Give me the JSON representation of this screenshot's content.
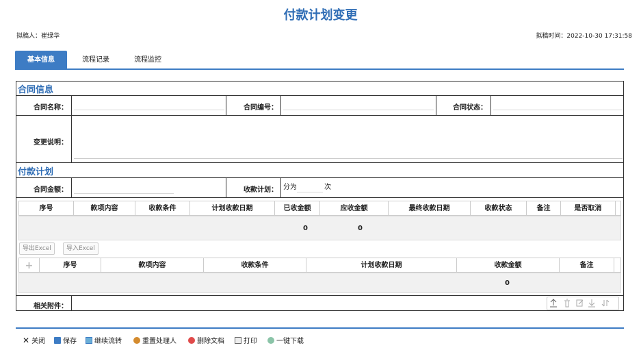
{
  "page": {
    "title": "付款计划变更",
    "drafter_label": "拟稿人：崔绿华",
    "draft_time_label": "拟稿时间：2022-10-30 17:31:58"
  },
  "tabs": [
    "基本信息",
    "流程记录",
    "流程监控"
  ],
  "contract_section": {
    "title": "合同信息",
    "name_label": "合同名称：",
    "number_label": "合同编号：",
    "status_label": "合同状态：",
    "change_desc_label": "变更说明："
  },
  "payment_section": {
    "title": "付款计划",
    "amount_label": "合同金额：",
    "plan_label": "收款计划：",
    "plan_prefix": "分为",
    "plan_suffix": "次"
  },
  "grid1": {
    "headers": [
      "序号",
      "款项内容",
      "收款条件",
      "计划收款日期",
      "已收金额",
      "应收金额",
      "最终收款日期",
      "收款状态",
      "备注",
      "是否取消"
    ],
    "totals": [
      "0",
      "0"
    ]
  },
  "grid_buttons": {
    "export": "导出Excel",
    "import": "导入Excel"
  },
  "grid2": {
    "headers": [
      "序号",
      "款项内容",
      "收款条件",
      "计划收款日期",
      "收款金额",
      "备注"
    ],
    "totals": [
      "0"
    ]
  },
  "attachments": {
    "label": "相关附件："
  },
  "bottom_actions": [
    {
      "label": "关闭",
      "icon": "close-icon"
    },
    {
      "label": "保存",
      "icon": "save-icon"
    },
    {
      "label": "继续流转",
      "icon": "forward-icon"
    },
    {
      "label": "重置处理人",
      "icon": "reset-user-icon"
    },
    {
      "label": "删除文档",
      "icon": "delete-icon"
    },
    {
      "label": "打印",
      "icon": "print-icon"
    },
    {
      "label": "一键下载",
      "icon": "download-icon"
    }
  ],
  "colors": {
    "accent": "#3d7cc4",
    "title": "#2f6db5"
  }
}
